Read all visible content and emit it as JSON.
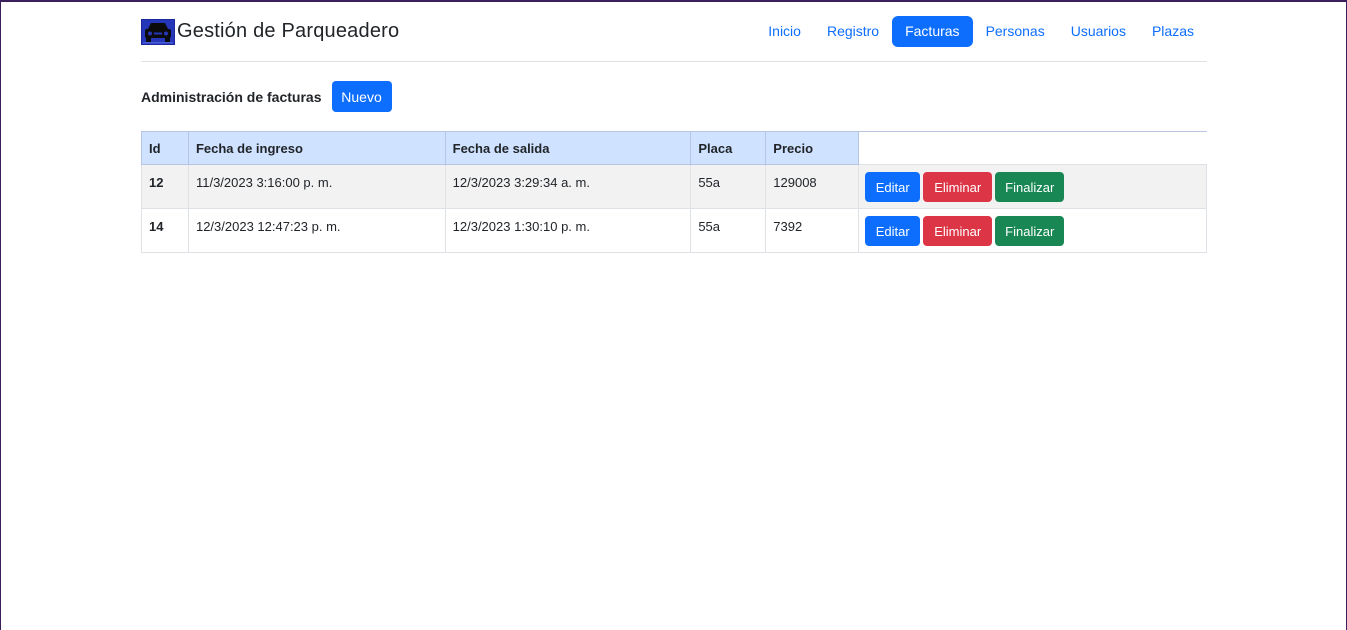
{
  "header": {
    "brand_title": "Gestión de Parqueadero",
    "logo_icon": "car-icon",
    "nav": [
      {
        "label": "Inicio",
        "active": false
      },
      {
        "label": "Registro",
        "active": false
      },
      {
        "label": "Facturas",
        "active": true
      },
      {
        "label": "Personas",
        "active": false
      },
      {
        "label": "Usuarios",
        "active": false
      },
      {
        "label": "Plazas",
        "active": false
      }
    ]
  },
  "admin": {
    "title": "Administración de facturas",
    "new_button": "Nuevo"
  },
  "table": {
    "headers": [
      "Id",
      "Fecha de ingreso",
      "Fecha de salida",
      "Placa",
      "Precio"
    ],
    "rows": [
      {
        "id": "12",
        "ingreso": "11/3/2023 3:16:00 p. m.",
        "salida": "12/3/2023 3:29:34 a. m.",
        "placa": "55a",
        "precio": "129008",
        "actions": [
          "Editar",
          "Eliminar",
          "Finalizar"
        ]
      },
      {
        "id": "14",
        "ingreso": "12/3/2023 12:47:23 p. m.",
        "salida": "12/3/2023 1:30:10 p. m.",
        "placa": "55a",
        "precio": "7392",
        "actions": [
          "Editar",
          "Eliminar",
          "Finalizar"
        ]
      }
    ]
  },
  "colors": {
    "primary": "#0d6efd",
    "danger": "#dc3545",
    "success": "#198754",
    "table_head": "#cfe2ff",
    "striped_row": "#f2f2f2"
  }
}
